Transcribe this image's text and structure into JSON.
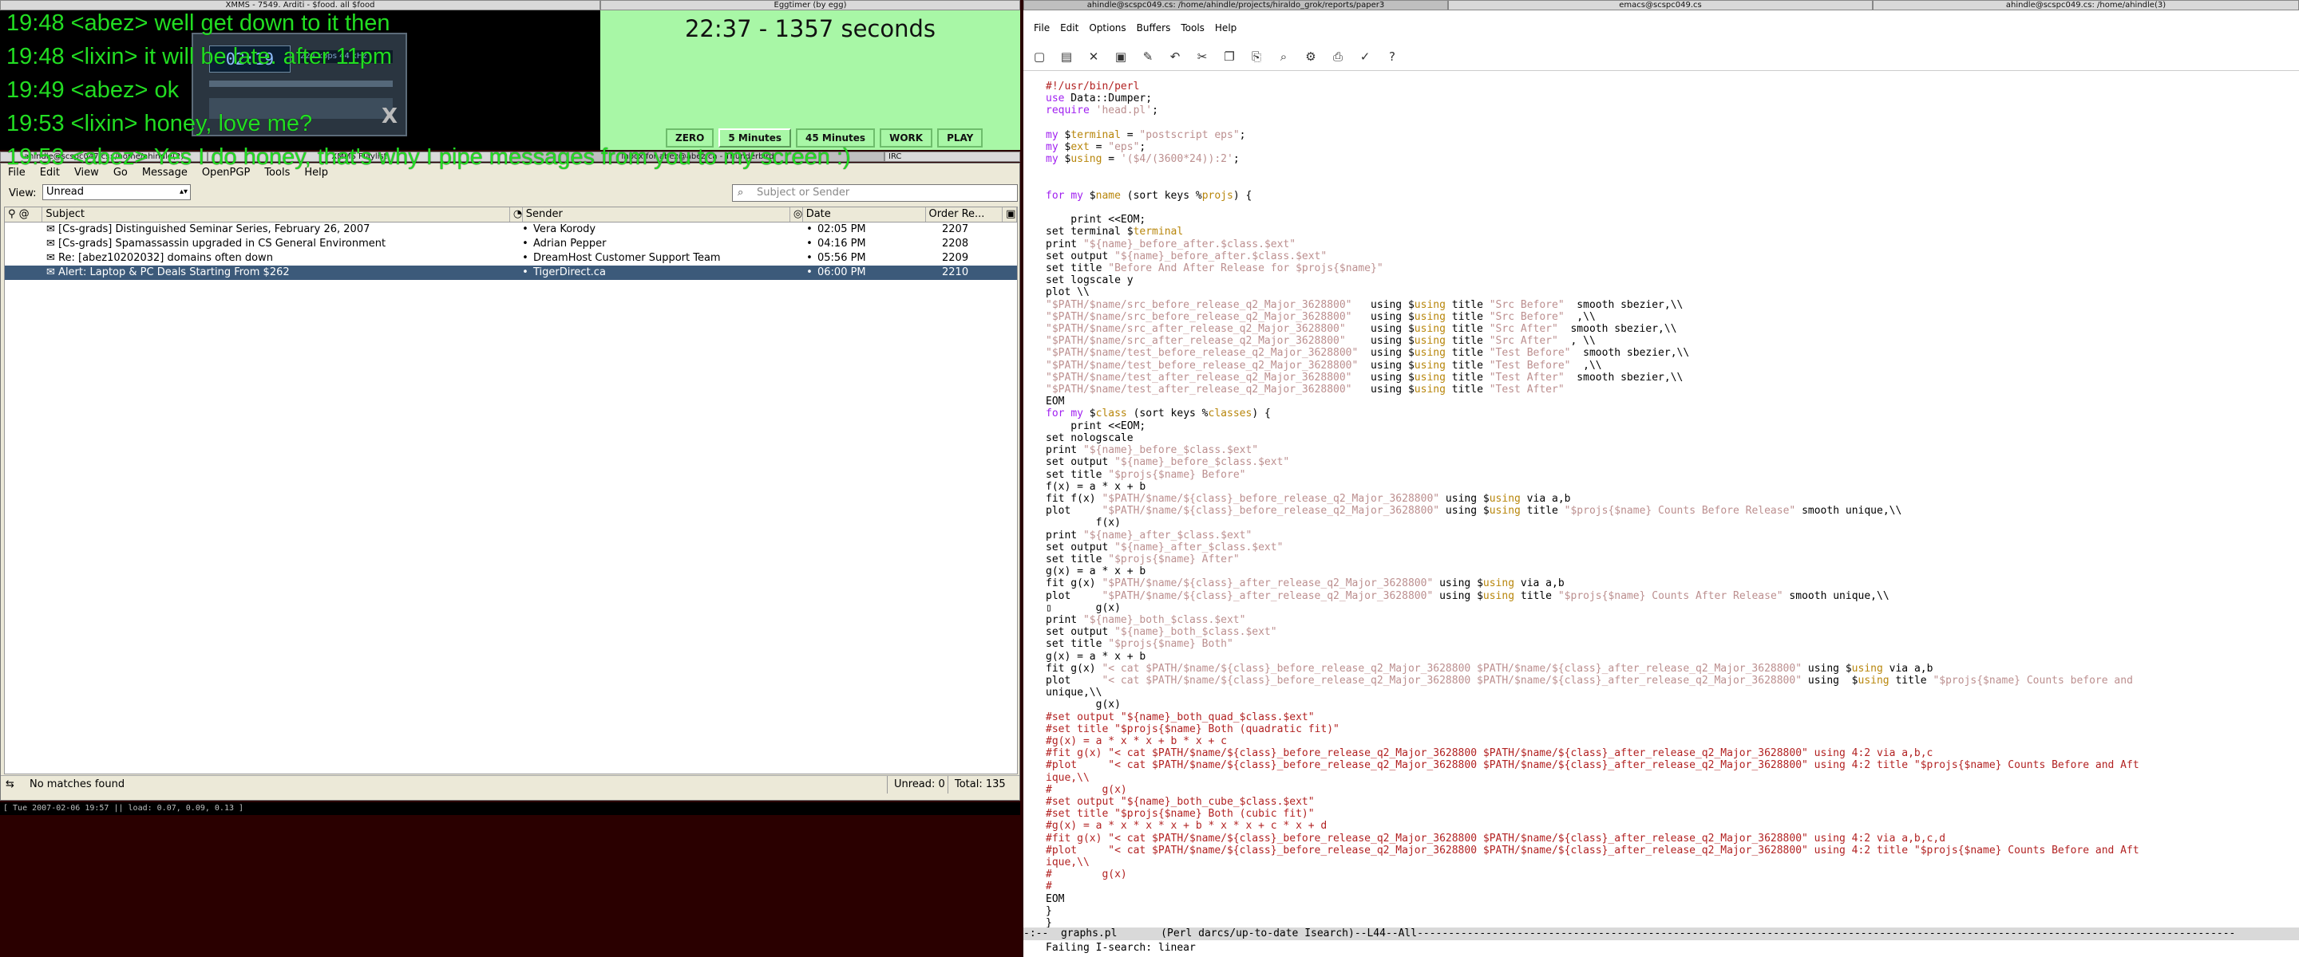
{
  "titles": {
    "xmms": "XMMS - 7549. Arditi - $food. all $food",
    "eggtimer": "Eggtimer (by egg)",
    "emacs_tab1": "ahindle@scspc049.cs: /home/ahindle/projects/hiraldo_grok/reports/paper3",
    "emacs_tab2": "emacs@scspc049.cs",
    "emacs_tab3": "ahindle@scspc049.cs: /home/ahindle(3)",
    "term": "ahindle@scspc047.cs: /home/ahindle(2)",
    "xmms_playlist": "XMMS Playlist",
    "thunderbird": "Inbox for abez@abez.ca - Thunderbird",
    "irc": "IRC"
  },
  "irc_lines": [
    "19:48 <abez> well get down to it then",
    "19:48 <lixin> it will be late. after 11pm",
    "19:49 <abez> ok",
    "19:53 <lixin> honey, love me?",
    "19:53 <abez> Yes I do honey, that's why I pipe messages from you to my screen :)"
  ],
  "xmms": {
    "time": "02:19",
    "info": "224 kbps  44 kHz"
  },
  "eggtimer": {
    "display": "22:37  -  1357 seconds",
    "buttons": [
      "ZERO",
      "5 Minutes",
      "45 Minutes",
      "WORK",
      "PLAY"
    ]
  },
  "thunderbird": {
    "menu": [
      "File",
      "Edit",
      "View",
      "Go",
      "Message",
      "OpenPGP",
      "Tools",
      "Help"
    ],
    "view_label": "View:",
    "view_value": "Unread",
    "search_placeholder": "Subject or Sender",
    "columns": {
      "subject": "Subject",
      "sender": "Sender",
      "date": "Date",
      "order": "Order Re..."
    },
    "messages": [
      {
        "subject": "[Cs-grads] Distinguished Seminar Series, February 26, 2007",
        "sender": "Vera Korody",
        "date": "02:05 PM",
        "order": "2207"
      },
      {
        "subject": "[Cs-grads] Spamassassin upgraded in CS General Environment",
        "sender": "Adrian Pepper",
        "date": "04:16 PM",
        "order": "2208"
      },
      {
        "subject": "Re: [abez10202032] domains often down",
        "sender": "DreamHost Customer Support Team",
        "date": "05:56 PM",
        "order": "2209"
      },
      {
        "subject": "Alert: Laptop & PC Deals Starting From $262",
        "sender": "TigerDirect.ca",
        "date": "06:00 PM",
        "order": "2210"
      }
    ],
    "status_text": "No matches found",
    "unread": "Unread: 0",
    "total": "Total: 135"
  },
  "statusline": "[ Tue 2007-02-06 19:57 || load: 0.07, 0.09, 0.13 ]",
  "emacs": {
    "menu": [
      "File",
      "Edit",
      "Options",
      "Buffers",
      "Tools",
      "Help"
    ],
    "modeline": "-:--  graphs.pl       (Perl darcs/up-to-date Isearch)--L44--All-----------------------------------------------------------------------------------------------------------------------------------",
    "minibuffer": "Failing I-search: linear"
  }
}
